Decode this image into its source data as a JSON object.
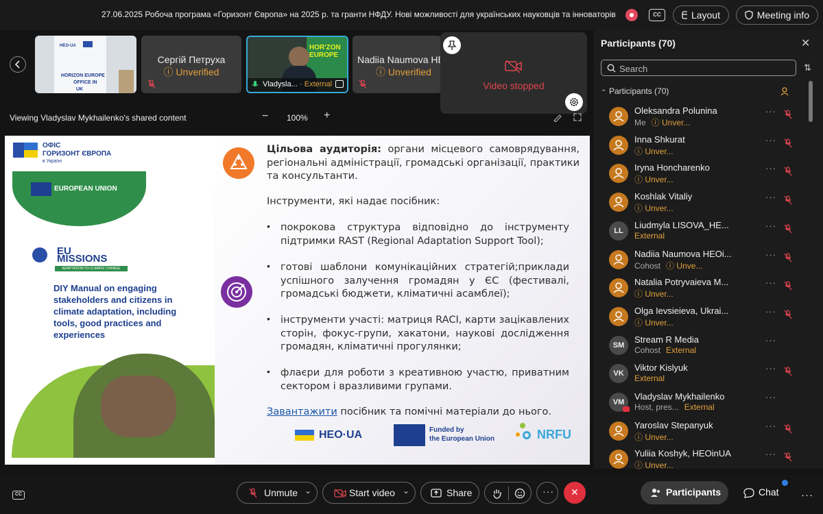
{
  "meeting": {
    "title": "27.06.2025 Робоча програма «Горизонт Європа» на 2025 р. та гранти НФДУ. Нові можливості для українських науковців та інноваторів",
    "layout_label": "Layout",
    "info_label": "Meeting info",
    "cc_label": "CC"
  },
  "thumbnails": [
    {
      "id": "room",
      "caption_logo": "HEO·UA",
      "sign_line1": "HORIZON EUROPE",
      "sign_line2": "OFFICE IN",
      "sign_line3": "UK"
    },
    {
      "id": "serhii",
      "name": "Сергій Петруха",
      "status": "Unverified"
    },
    {
      "id": "vladyslav",
      "name": "Vladysla...",
      "status": "External",
      "banner": "HOR'ZON EUROPE"
    },
    {
      "id": "nadiia",
      "name": "Nadiia Naumova HE",
      "status": "Unverified"
    }
  ],
  "video_stopped": {
    "label": "Video stopped"
  },
  "share": {
    "viewing_label": "Viewing Vladyslav Mykhailenko's shared content",
    "zoom": "100%"
  },
  "slide": {
    "logo_office_line1": "ОФІС",
    "logo_office_line2": "ГОРИЗОНТ ЄВРОПА",
    "logo_office_line3": "в Україні",
    "eu_banner": "EUROPEAN UNION",
    "eu_missions_1": "EU",
    "eu_missions_2": "MISSIONS",
    "eu_missions_sub": "ADAPTATION TO CLIMATE CHANGE",
    "manual_title": "DIY Manual on engaging stakeholders and citizens in climate adaptation, including tools, good practices and experiences",
    "audience_label": "Цільова аудиторія:",
    "audience_text": "органи місцевого самоврядування, регіональні адміністрації, громадські організації, практики та консультанти.",
    "tools_intro": "Інструменти, які надає посібник:",
    "bullets": [
      "покрокова структура відповідно до інструменту підтримки RAST (Regional Adaptation Support Tool);",
      "готові шаблони комунікаційних стратегій;приклади успішного залучення громадян у ЄС (фестивалі, громадські бюджети, кліматичні асамблеї);",
      "інструменти участі: матриця RACI, карти зацікавлених сторін, фокус-групи, хакатони, наукові дослідження громадян, кліматичні прогулянки;",
      "флаєри для роботи з креативною участю, приватним сектором і вразливими групами."
    ],
    "download_link": "Завантажити",
    "download_rest": "посібник та помічні матеріали до нього.",
    "footer_heo": "HEO·UA",
    "footer_funded_1": "Funded by",
    "footer_funded_2": "the European Union",
    "footer_nrfu": "NRFU"
  },
  "participants_panel": {
    "title": "Participants (70)",
    "search_placeholder": "Search",
    "group_label": "Participants (70)",
    "people": [
      {
        "name": "Oleksandra Polunina",
        "role": "Me",
        "status": "Unver...",
        "avatar": "",
        "color": "orange",
        "muted": true
      },
      {
        "name": "Inna Shkurat",
        "role": "",
        "status": "Unver...",
        "avatar": "",
        "color": "orange",
        "muted": true
      },
      {
        "name": "Iryna Honcharenko",
        "role": "",
        "status": "Unver...",
        "avatar": "",
        "color": "orange",
        "muted": true
      },
      {
        "name": "Koshlak Vitaliy",
        "role": "",
        "status": "Unver...",
        "avatar": "",
        "color": "orange",
        "muted": true
      },
      {
        "name": "Liudmyla LISOVA_HE...",
        "role": "",
        "status": "External",
        "avatar": "LL",
        "color": "gray",
        "muted": true
      },
      {
        "name": "Nadiia Naumova HEOi...",
        "role": "Cohost",
        "status": "Unve...",
        "avatar": "",
        "color": "orange",
        "muted": true
      },
      {
        "name": "Natalia Potryvaieva M...",
        "role": "",
        "status": "Unver...",
        "avatar": "",
        "color": "orange",
        "muted": true
      },
      {
        "name": "Olga Ievsieieva, Ukrai...",
        "role": "",
        "status": "Unver...",
        "avatar": "",
        "color": "orange",
        "muted": true
      },
      {
        "name": "Stream R Media",
        "role": "Cohost",
        "status": "External",
        "avatar": "SM",
        "color": "gray",
        "muted": false
      },
      {
        "name": "Viktor Kislyuk",
        "role": "",
        "status": "External",
        "avatar": "VK",
        "color": "gray",
        "muted": true
      },
      {
        "name": "Vladyslav Mykhailenko",
        "role": "Host, pres...",
        "status": "External",
        "avatar": "VM",
        "color": "gray",
        "muted": false
      },
      {
        "name": "Yaroslav Stepanyuk",
        "role": "",
        "status": "Unver...",
        "avatar": "",
        "color": "orange",
        "muted": true
      },
      {
        "name": "Yuliia Koshyk, HEOinUA",
        "role": "",
        "status": "Unver...",
        "avatar": "",
        "color": "orange",
        "muted": true
      }
    ]
  },
  "controls": {
    "unmute": "Unmute",
    "start_video": "Start video",
    "share": "Share",
    "participants": "Participants",
    "chat": "Chat"
  },
  "colors": {
    "accent_orange": "#e2a03c",
    "external_orange": "#e2a03c",
    "leave_red": "#e0303e",
    "link_blue": "#1a56a8"
  }
}
